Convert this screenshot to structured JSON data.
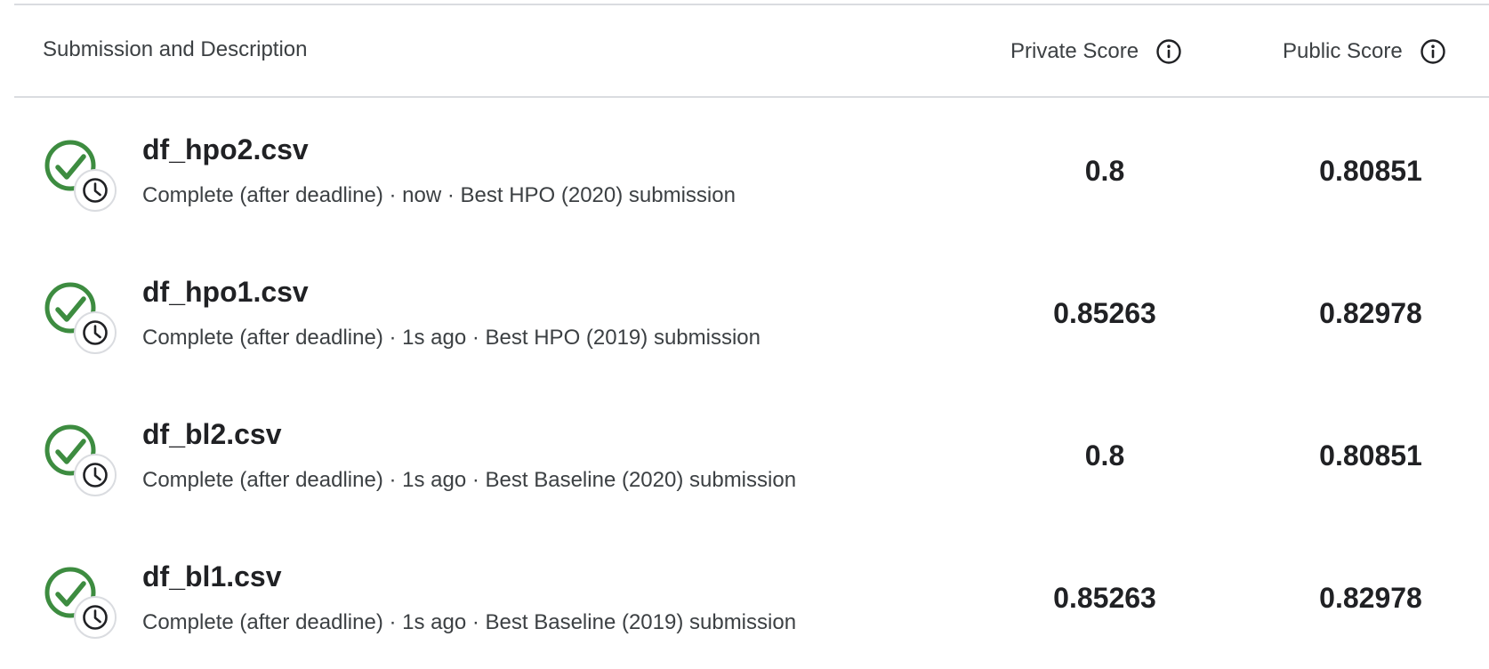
{
  "header": {
    "title": "Submission and Description",
    "private_score_label": "Private Score",
    "public_score_label": "Public Score"
  },
  "icons": {
    "info": "info-icon",
    "status_complete": "check-circle-icon",
    "status_late": "clock-icon"
  },
  "colors": {
    "success": "#3d8c40",
    "text_primary": "#202124",
    "text_secondary": "#3c4043",
    "divider": "#dadce0"
  },
  "submissions": [
    {
      "file": "df_hpo2.csv",
      "status": "Complete (after deadline)",
      "time": "now",
      "description": "Best HPO (2020) submission",
      "private_score": "0.8",
      "public_score": "0.80851"
    },
    {
      "file": "df_hpo1.csv",
      "status": "Complete (after deadline)",
      "time": "1s ago",
      "description": "Best HPO (2019) submission",
      "private_score": "0.85263",
      "public_score": "0.82978"
    },
    {
      "file": "df_bl2.csv",
      "status": "Complete (after deadline)",
      "time": "1s ago",
      "description": "Best Baseline (2020) submission",
      "private_score": "0.8",
      "public_score": "0.80851"
    },
    {
      "file": "df_bl1.csv",
      "status": "Complete (after deadline)",
      "time": "1s ago",
      "description": "Best Baseline (2019) submission",
      "private_score": "0.85263",
      "public_score": "0.82978"
    }
  ]
}
